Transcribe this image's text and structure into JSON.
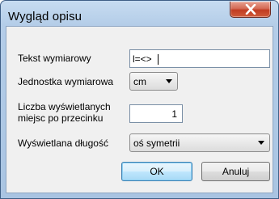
{
  "window": {
    "title": "Wygląd opisu",
    "close_icon": "close-icon"
  },
  "fields": {
    "tekst_label": "Tekst wymiarowy",
    "tekst_value": "l=<>",
    "jednostka_label": "Jednostka wymiarowa",
    "jednostka_value": "cm",
    "liczba_label_line1": "Liczba wyświetlanych",
    "liczba_label_line2": "miejsc po przecinku",
    "liczba_value": "1",
    "dlugosc_label": "Wyświetlana długość",
    "dlugosc_value": "oś symetrii"
  },
  "buttons": {
    "ok": "OK",
    "cancel": "Anuluj"
  }
}
